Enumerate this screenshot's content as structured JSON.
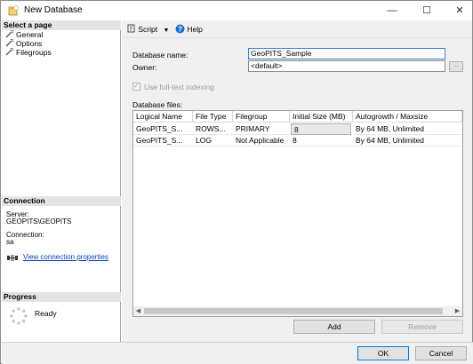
{
  "window": {
    "title": "New Database"
  },
  "left": {
    "select_page_header": "Select a page",
    "pages": [
      {
        "label": "General",
        "icon": "wrench-icon"
      },
      {
        "label": "Options",
        "icon": "wrench-icon"
      },
      {
        "label": "Filegroups",
        "icon": "wrench-icon"
      }
    ],
    "connection_header": "Connection",
    "server_label": "Server:",
    "server_value": "GEOPITS\\GEOPITS",
    "connection_label": "Connection:",
    "connection_value": "sa",
    "view_connection_properties": "View connection properties",
    "progress_header": "Progress",
    "progress_status": "Ready"
  },
  "toolbar": {
    "script_label": "Script",
    "help_label": "Help"
  },
  "form": {
    "database_name_label": "Database name:",
    "database_name_value": "GeoPITS_Sample",
    "owner_label": "Owner:",
    "owner_value": "<default>",
    "browse_label": "...",
    "fulltext_label": "Use full-text indexing",
    "database_files_label": "Database files:"
  },
  "files_table": {
    "columns": [
      "Logical Name",
      "File Type",
      "Filegroup",
      "Initial Size (MB)",
      "Autogrowth / Maxsize"
    ],
    "rows": [
      [
        "GeoPITS_S...",
        "ROWS...",
        "PRIMARY",
        "8",
        "By 64 MB, Unlimited"
      ],
      [
        "GeoPITS_S...",
        "LOG",
        "Not Applicable",
        "8",
        "By 64 MB, Unlimited"
      ]
    ]
  },
  "buttons": {
    "add": "Add",
    "remove": "Remove",
    "ok": "OK",
    "cancel": "Cancel"
  },
  "colors": {
    "accent": "#0078d7",
    "link": "#0645ad"
  }
}
